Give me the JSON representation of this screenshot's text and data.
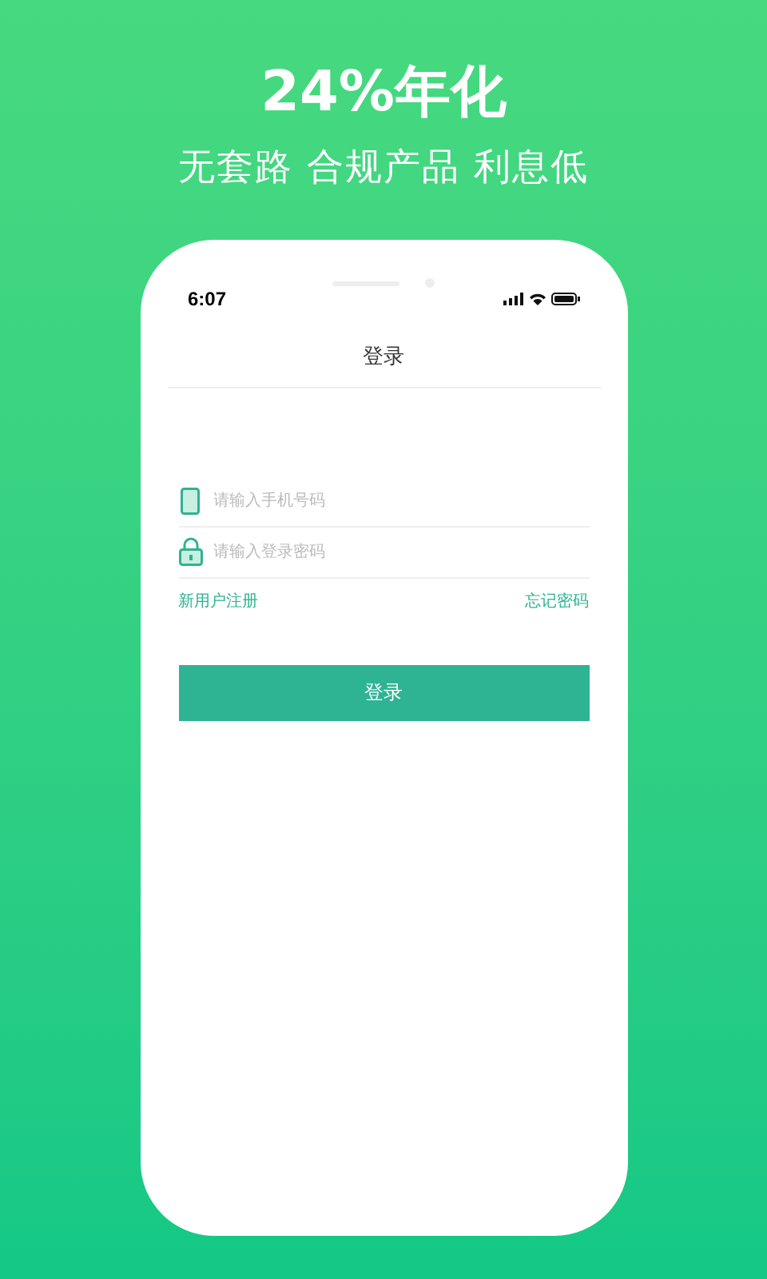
{
  "headline": "24%年化",
  "tagline": "无套路 合规产品 利息低",
  "phone": {
    "status_bar": {
      "time": "6:07"
    },
    "title": "登录",
    "fields": [
      {
        "kind": "phone",
        "placeholder": "请输入手机号码"
      },
      {
        "kind": "password",
        "placeholder": "请输入登录密码"
      }
    ],
    "links": [
      {
        "label": "新用户注册"
      },
      {
        "label": "忘记密码"
      }
    ],
    "button": "登录"
  }
}
